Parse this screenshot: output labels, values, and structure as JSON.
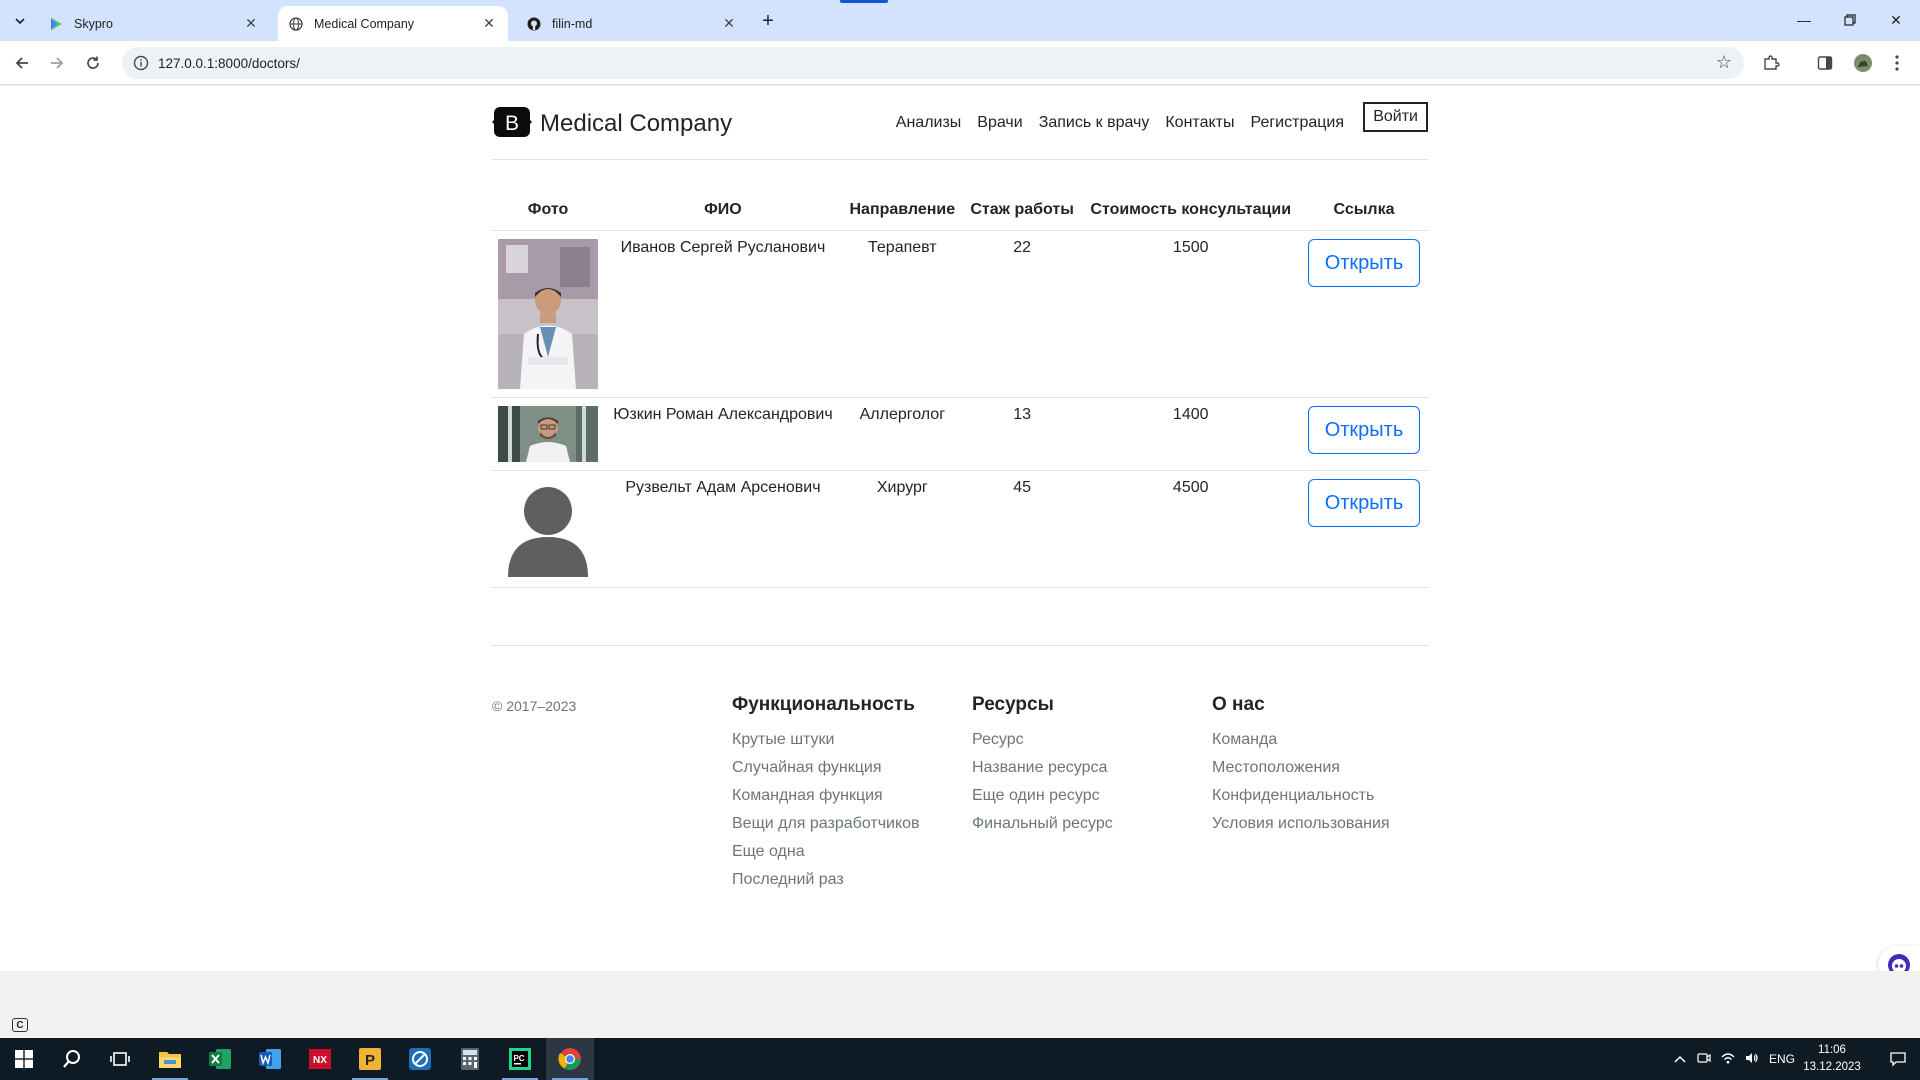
{
  "browser": {
    "tabs": [
      {
        "title": "Skypro"
      },
      {
        "title": "Medical Company"
      },
      {
        "title": "filin-md"
      }
    ],
    "url": "127.0.0.1:8000/doctors/"
  },
  "site": {
    "brand_letter": "B",
    "brand_name": "Medical Company",
    "nav": [
      "Анализы",
      "Врачи",
      "Запись к врачу",
      "Контакты",
      "Регистрация"
    ],
    "login_label": "Войти"
  },
  "table": {
    "headers": [
      "Фото",
      "ФИО",
      "Направление",
      "Стаж работы",
      "Стоимость консультации",
      "Ссылка"
    ],
    "rows": [
      {
        "name": "Иванов Сергей Русланович",
        "specialty": "Терапевт",
        "experience": "22",
        "price": "1500",
        "link_label": "Открыть"
      },
      {
        "name": "Юзкин Роман Александрович",
        "specialty": "Аллерголог",
        "experience": "13",
        "price": "1400",
        "link_label": "Открыть"
      },
      {
        "name": "Рузвельт Адам Арсенович",
        "specialty": "Хирург",
        "experience": "45",
        "price": "4500",
        "link_label": "Открыть"
      }
    ]
  },
  "footer": {
    "copyright": "© 2017–2023",
    "columns": [
      {
        "title": "Функциональность",
        "links": [
          "Крутые штуки",
          "Случайная функция",
          "Командная функция",
          "Вещи для разработчиков",
          "Еще одна",
          "Последний раз"
        ]
      },
      {
        "title": "Ресурсы",
        "links": [
          "Ресурс",
          "Название ресурса",
          "Еще один ресурс",
          "Финальный ресурс"
        ]
      },
      {
        "title": "О нас",
        "links": [
          "Команда",
          "Местоположения",
          "Конфиденциальность",
          "Условия использования"
        ]
      }
    ]
  },
  "taskbar": {
    "language": "ENG",
    "time": "11:06",
    "date": "13.12.2023"
  },
  "colors": {
    "accent": "#0d6efd",
    "tabbar": "#d3e3fd",
    "taskbar": "#0e1a24"
  }
}
